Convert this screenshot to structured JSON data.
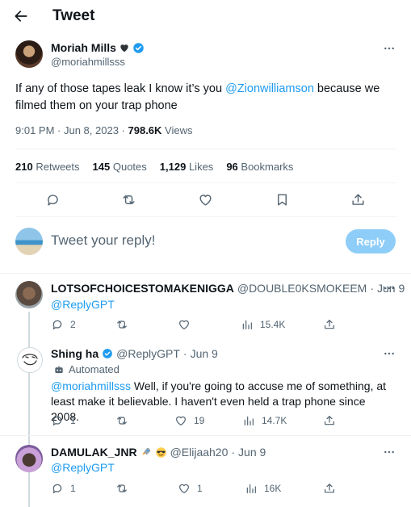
{
  "header": {
    "title": "Tweet"
  },
  "tweet": {
    "author_name": "Moriah Mills",
    "author_handle": "@moriahmillsss",
    "text_before": "If any of those tapes leak I know it’s you ",
    "mention": "@Zionwilliamson",
    "text_after": " because we filmed them on your trap phone",
    "time": "9:01 PM",
    "date": "Jun 8, 2023",
    "views_count": "798.6K",
    "views_label": "Views",
    "retweets_count": "210",
    "retweets_label": "Retweets",
    "quotes_count": "145",
    "quotes_label": "Quotes",
    "likes_count": "1,129",
    "likes_label": "Likes",
    "bookmarks_count": "96",
    "bookmarks_label": "Bookmarks"
  },
  "composer": {
    "placeholder": "Tweet your reply!",
    "button_label": "Reply"
  },
  "replies": [
    {
      "name": "LOTSOFCHOICESTOMAKENIGGA",
      "handle": "@DOUBLE0KSMOKEEM",
      "date": "Jun 9",
      "mention": "@ReplyGPT",
      "replies_count": "2",
      "views_count": "15.4K"
    },
    {
      "name": "Shing ha",
      "handle": "@ReplyGPT",
      "date": "Jun 9",
      "automated_label": "Automated",
      "mention": "@moriahmillsss",
      "text": " Well, if you're going to accuse me of something, at least make it believable. I haven't even held a trap phone since 2008.",
      "replies_count": "1",
      "likes_count": "19",
      "views_count": "14.7K"
    },
    {
      "name": "DAMULAK_JNR",
      "handle": "@Elijaah20",
      "date": "Jun 9",
      "mention": "@ReplyGPT",
      "replies_count": "1",
      "likes_count": "1",
      "views_count": "16K"
    }
  ],
  "colors": {
    "accent": "#1d9bf0",
    "reply_button": "#8ecdf8",
    "text": "#0f1419",
    "muted": "#536471"
  }
}
